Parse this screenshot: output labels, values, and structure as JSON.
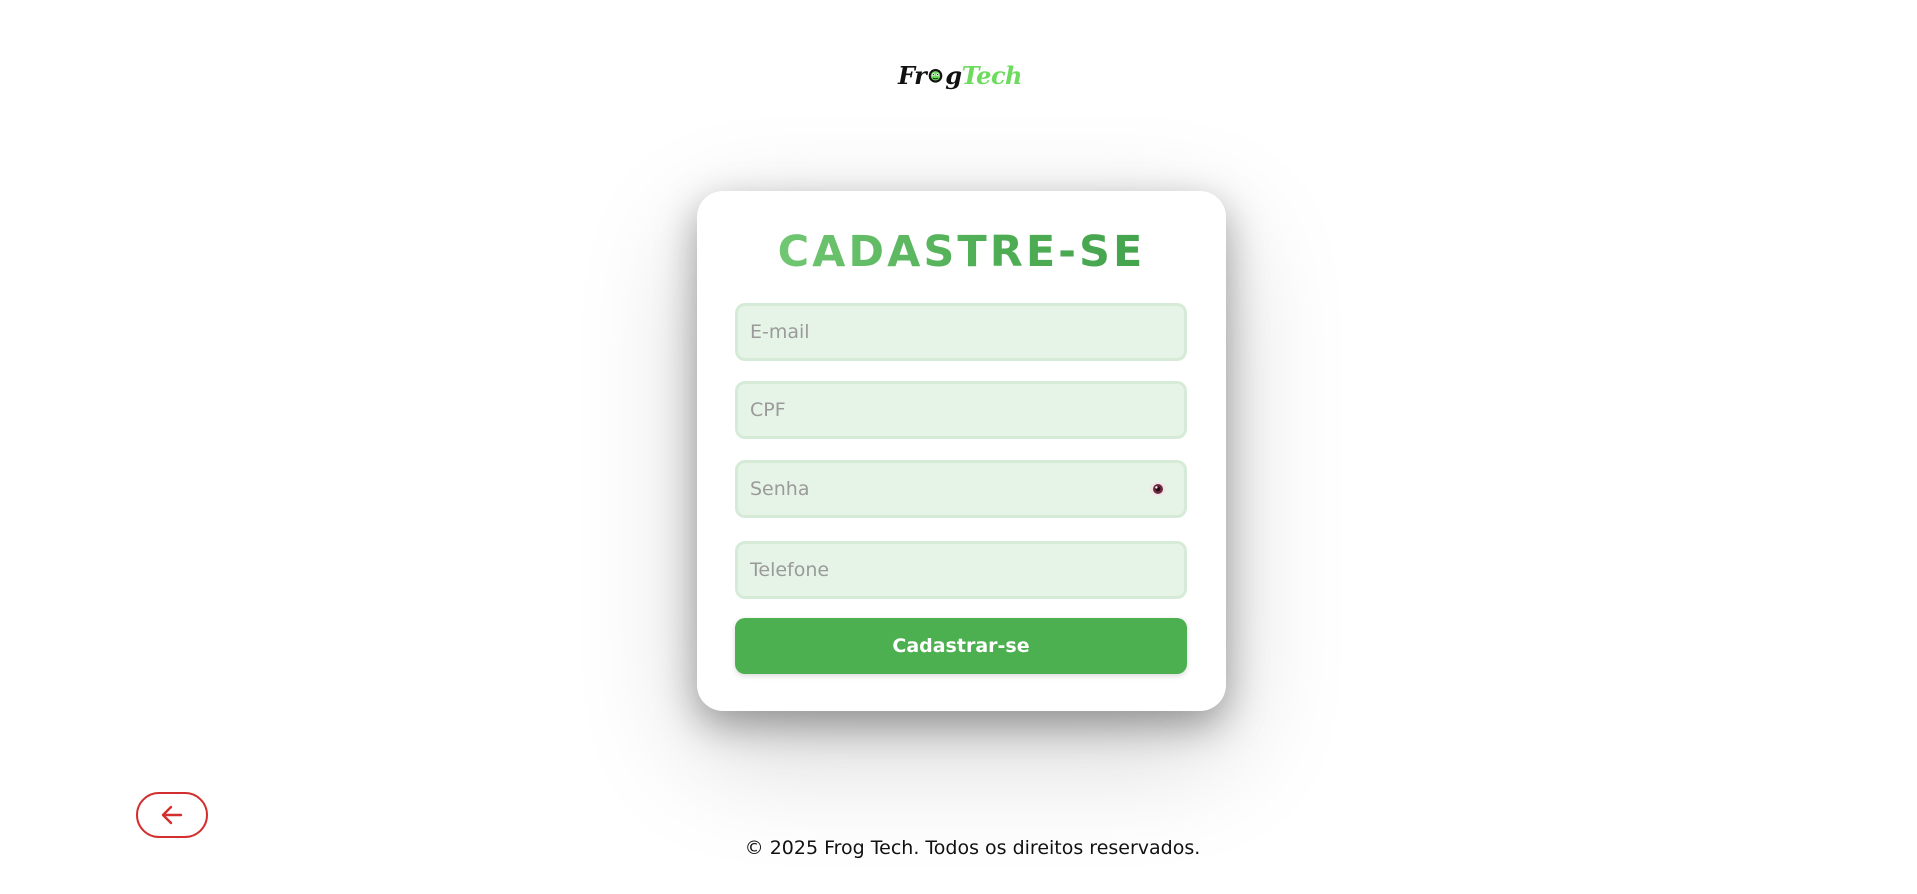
{
  "logo": {
    "text_part_a": "Fr",
    "text_part_b": "g",
    "text_part_c": "Tech",
    "dark_color": "#111111",
    "accent_color": "#6ddc5e"
  },
  "form": {
    "title": "CADASTRE-SE",
    "title_gradient": [
      "#7fd07e",
      "#3f9e4a"
    ],
    "fields": {
      "email": {
        "placeholder": "E-mail",
        "value": ""
      },
      "cpf": {
        "placeholder": "CPF",
        "value": ""
      },
      "senha": {
        "placeholder": "Senha",
        "value": "",
        "toggle_icon": "eye-icon"
      },
      "telefone": {
        "placeholder": "Telefone",
        "value": ""
      }
    },
    "field_background": "#e6f4e7",
    "submit_label": "Cadastrar-se",
    "submit_color": "#4caf50"
  },
  "back_button": {
    "icon": "arrow-left-icon",
    "color": "#d32f2f"
  },
  "footer": {
    "text": "© 2025 Frog Tech. Todos os direitos reservados."
  }
}
